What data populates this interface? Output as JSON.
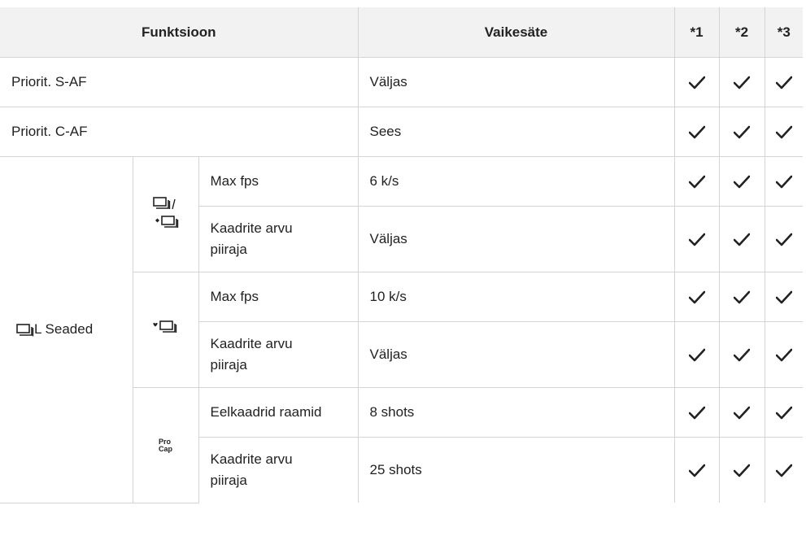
{
  "header": {
    "funktsioon": "Funktsioon",
    "vaikesate": "Vaikesäte",
    "col1": "*1",
    "col2": "*2",
    "col3": "*3"
  },
  "rows": {
    "priorit_saf": {
      "label": "Priorit. S-AF",
      "value": "Väljas"
    },
    "priorit_caf": {
      "label": "Priorit. C-AF",
      "value": "Sees"
    },
    "seq_settings": {
      "label": "L Seaded",
      "icon": "sequential-shooting-icon"
    },
    "group1": {
      "icon": "sequential-silent-icon",
      "max_fps": {
        "label": "Max fps",
        "value": "6 k/s"
      },
      "limit": {
        "label": "Kaadrite arvu piiraja",
        "value": "Väljas"
      }
    },
    "group2": {
      "icon": "sequential-high-icon",
      "max_fps": {
        "label": "Max fps",
        "value": "10 k/s"
      },
      "limit": {
        "label": "Kaadrite arvu piiraja",
        "value": "Väljas"
      }
    },
    "group3": {
      "icon_text_top": "Pro",
      "icon_text_bottom": "Cap",
      "pre": {
        "label": "Eelkaadrid raamid",
        "value": "8 shots"
      },
      "limit": {
        "label": "Kaadrite arvu piiraja",
        "value": "25 shots"
      }
    }
  },
  "check_icon": "checkmark-icon",
  "colors": {
    "header_bg": "#f2f2f2",
    "border": "#d4d4d4",
    "text": "#222222"
  }
}
